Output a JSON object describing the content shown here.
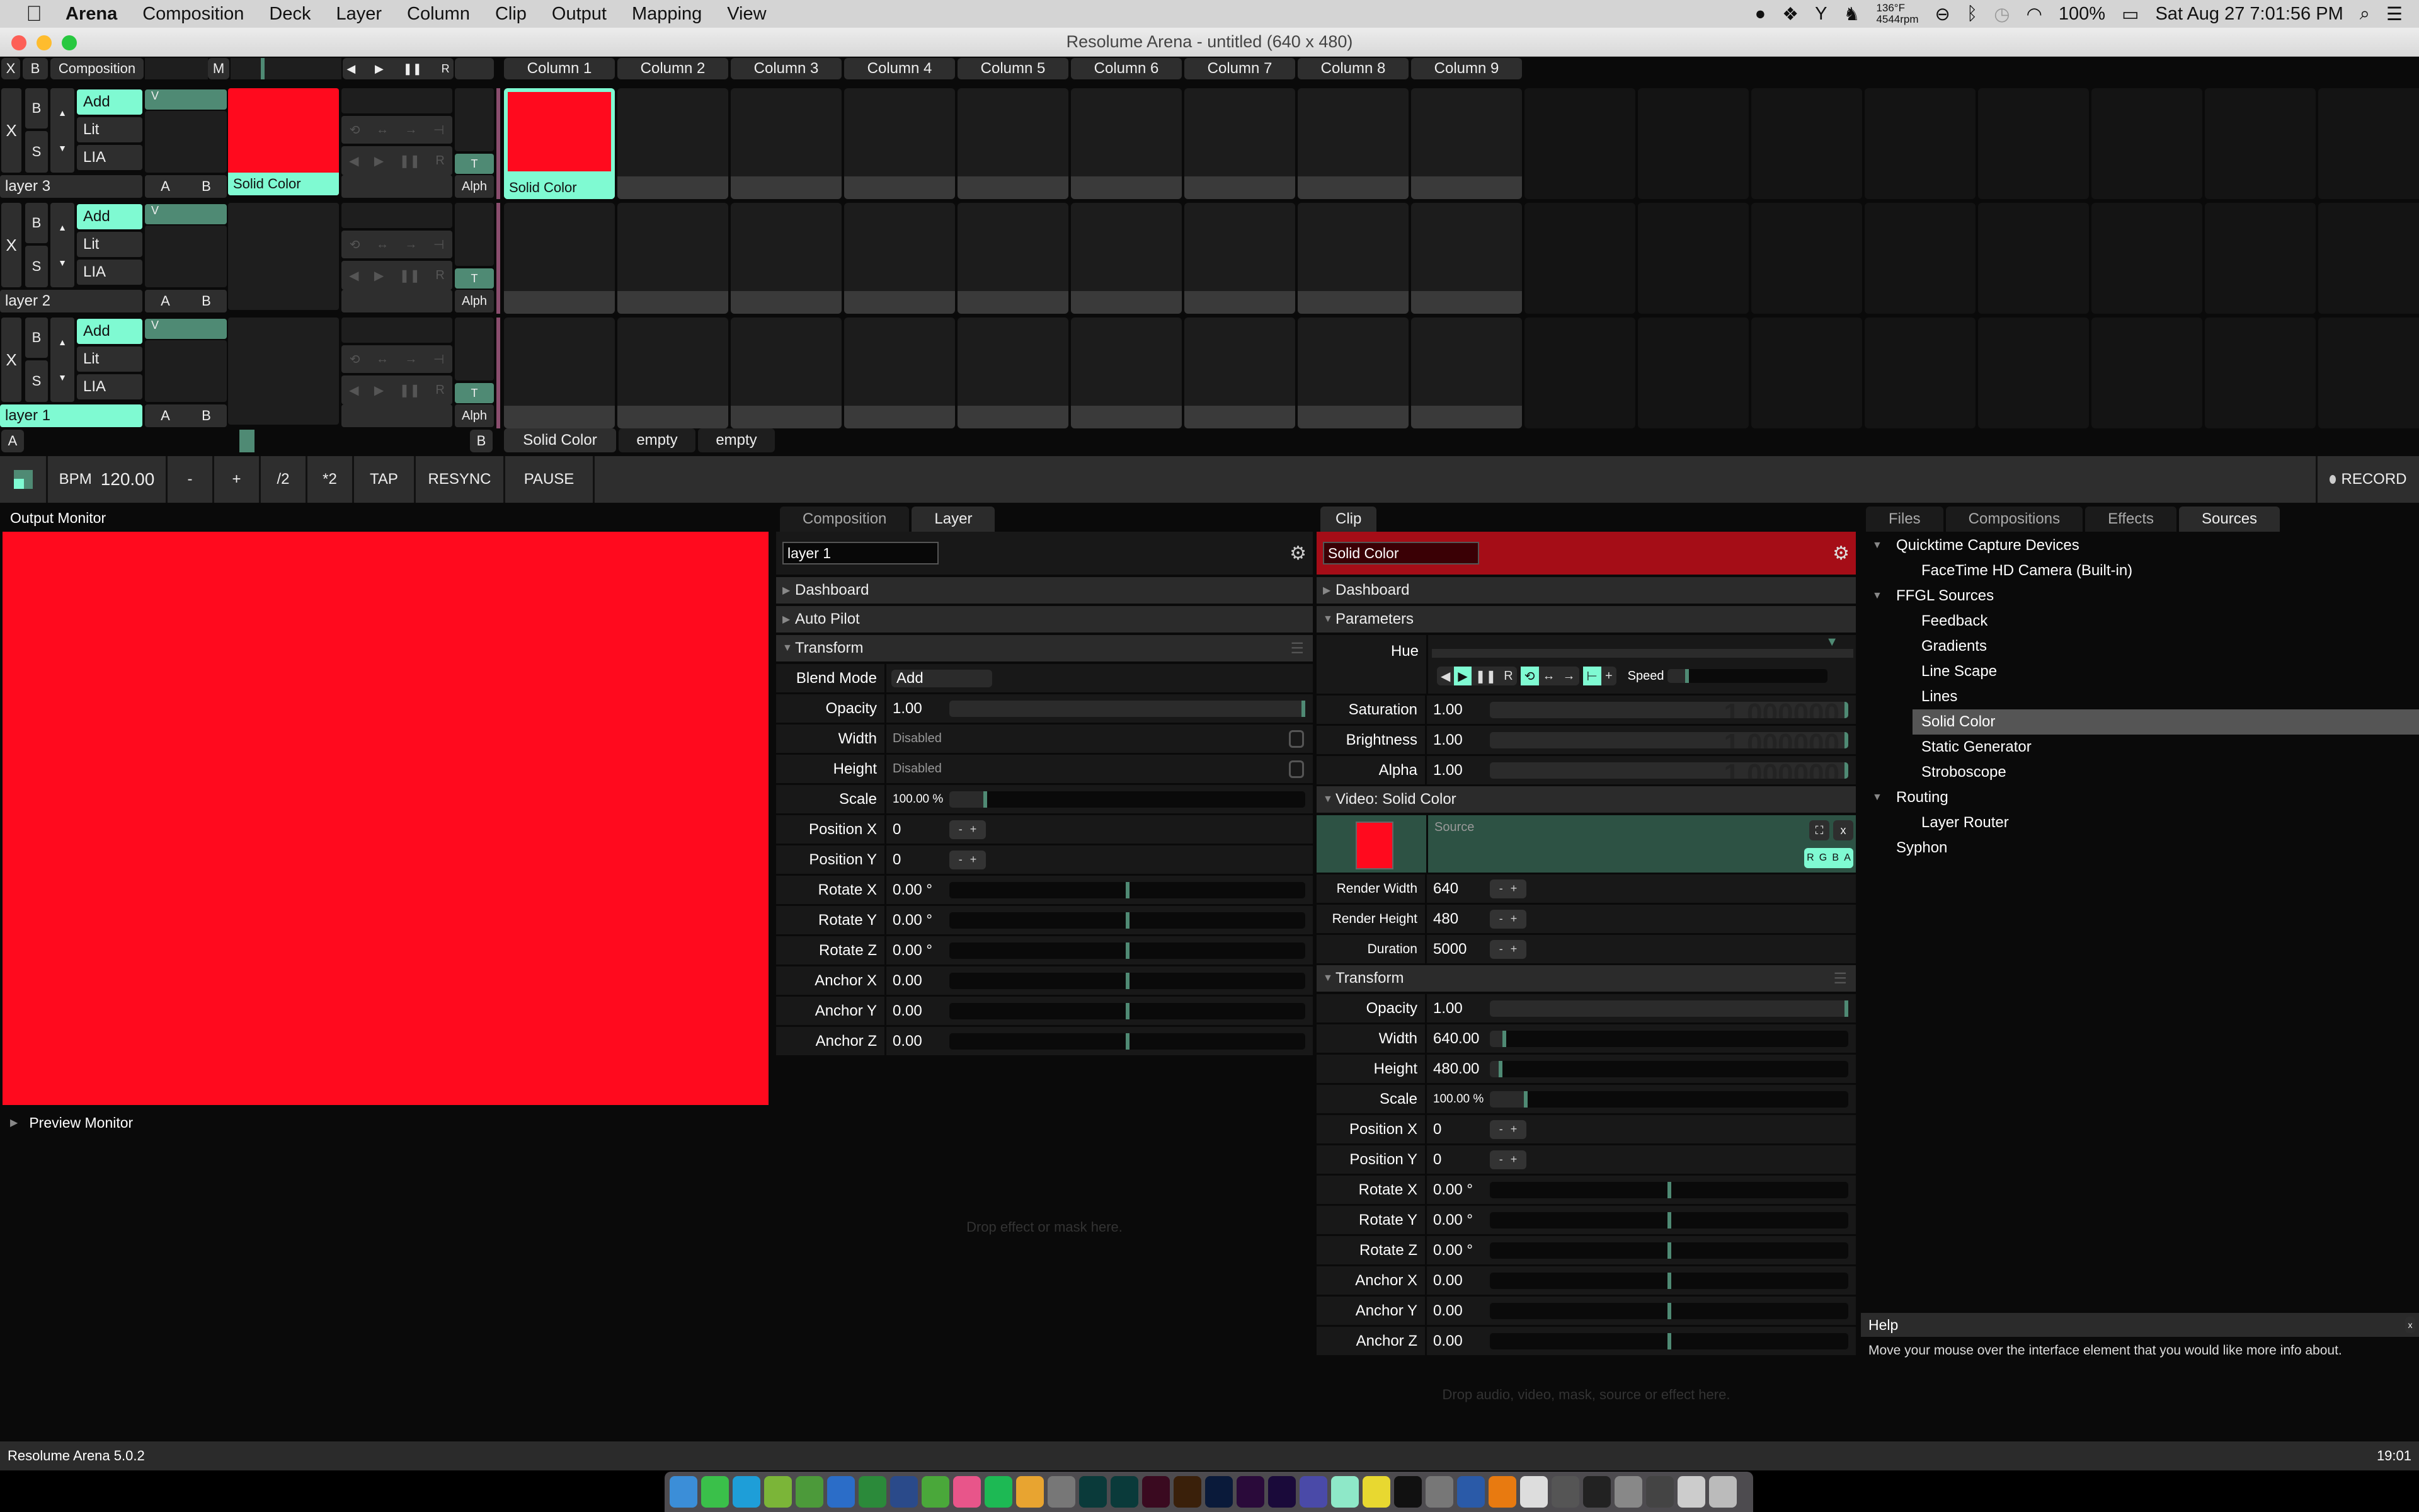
{
  "menubar": {
    "app_name": "Arena",
    "items": [
      "Composition",
      "Deck",
      "Layer",
      "Column",
      "Clip",
      "Output",
      "Mapping",
      "View"
    ],
    "status": {
      "temp": "136°F",
      "fan": "4544rpm",
      "battery": "100%",
      "datetime": "Sat Aug 27  7:01:56 PM"
    }
  },
  "window": {
    "title": "Resolume Arena - untitled (640 x 480)"
  },
  "deck": {
    "head": {
      "x": "X",
      "b": "B",
      "composition": "Composition",
      "m": "M",
      "prev": "◀",
      "next": "▶",
      "pause": "❚❚",
      "r": "R"
    },
    "columns": [
      "Column 1",
      "Column 2",
      "Column 3",
      "Column 4",
      "Column 5",
      "Column 6",
      "Column 7",
      "Column 8",
      "Column 9"
    ],
    "layers": [
      {
        "name": "layer 3",
        "blend": "Add",
        "lit": "Lit",
        "lia": "LIA",
        "v": "V",
        "t": "T",
        "alph": "Alph",
        "a": "A",
        "b": "B",
        "x": "X",
        "bypass": "B",
        "solo": "S",
        "preview_clip": "Solid Color",
        "active_clip": "Solid Color",
        "selected": false
      },
      {
        "name": "layer 2",
        "blend": "Add",
        "lit": "Lit",
        "lia": "LIA",
        "v": "V",
        "t": "T",
        "alph": "Alph",
        "a": "A",
        "b": "B",
        "x": "X",
        "bypass": "B",
        "solo": "S",
        "preview_clip": "",
        "active_clip": "",
        "selected": false
      },
      {
        "name": "layer 1",
        "blend": "Add",
        "lit": "Lit",
        "lia": "LIA",
        "v": "V",
        "t": "T",
        "alph": "Alph",
        "a": "A",
        "b": "B",
        "x": "X",
        "bypass": "B",
        "solo": "S",
        "preview_clip": "",
        "active_clip": "",
        "selected": true
      }
    ],
    "crossfader": {
      "a": "A",
      "b": "B",
      "position": 0.5
    },
    "decks": [
      "Solid Color",
      "empty",
      "empty"
    ]
  },
  "transport": {
    "bpm_label": "BPM",
    "bpm": "120.00",
    "minus": "-",
    "plus": "+",
    "half": "/2",
    "double": "*2",
    "tap": "TAP",
    "resync": "RESYNC",
    "pause": "PAUSE",
    "record": "RECORD"
  },
  "output_monitor": {
    "title": "Output Monitor",
    "color": "#ff0a1e",
    "preview": "Preview Monitor"
  },
  "layer_panel": {
    "tabs": [
      {
        "label": "Composition",
        "active": false
      },
      {
        "label": "Layer",
        "active": true
      }
    ],
    "name": "layer 1",
    "sections": {
      "dashboard": "Dashboard",
      "autopilot": "Auto Pilot",
      "transform": "Transform"
    },
    "blend_mode": {
      "label": "Blend Mode",
      "value": "Add"
    },
    "opacity": {
      "label": "Opacity",
      "value": "1.00",
      "fraction": 1.0
    },
    "width": {
      "label": "Width",
      "value": "Disabled"
    },
    "height": {
      "label": "Height",
      "value": "Disabled"
    },
    "scale": {
      "label": "Scale",
      "value": "100.00 %",
      "fraction": 0.1
    },
    "position_x": {
      "label": "Position X",
      "value": "0"
    },
    "position_y": {
      "label": "Position Y",
      "value": "0"
    },
    "sliders": [
      {
        "label": "Rotate X",
        "value": "0.00 °",
        "fraction": 0.5
      },
      {
        "label": "Rotate Y",
        "value": "0.00 °",
        "fraction": 0.5
      },
      {
        "label": "Rotate Z",
        "value": "0.00 °",
        "fraction": 0.5
      },
      {
        "label": "Anchor X",
        "value": "0.00",
        "fraction": 0.5
      },
      {
        "label": "Anchor Y",
        "value": "0.00",
        "fraction": 0.5
      },
      {
        "label": "Anchor Z",
        "value": "0.00",
        "fraction": 0.5
      }
    ],
    "drop_hint": "Drop effect or mask here."
  },
  "clip_panel": {
    "tab": "Clip",
    "name": "Solid Color",
    "sections": {
      "dashboard": "Dashboard",
      "parameters": "Parameters",
      "video": "Video: Solid Color",
      "transform": "Transform"
    },
    "hue": {
      "label": "Hue",
      "speed_label": "Speed",
      "speed_fraction": 0.12
    },
    "params": [
      {
        "label": "Saturation",
        "value": "1.00",
        "ghost": "1.000000",
        "fraction": 1.0
      },
      {
        "label": "Brightness",
        "value": "1.00",
        "ghost": "1.000000",
        "fraction": 1.0
      },
      {
        "label": "Alpha",
        "value": "1.00",
        "ghost": "1.000000",
        "fraction": 1.0
      }
    ],
    "source": {
      "label": "Source",
      "rgba": [
        "R",
        "G",
        "B",
        "A"
      ],
      "color": "#ff0a1e"
    },
    "render": [
      {
        "label": "Render Width",
        "value": "640"
      },
      {
        "label": "Render Height",
        "value": "480"
      },
      {
        "label": "Duration",
        "value": "5000"
      }
    ],
    "transform_sliders": [
      {
        "label": "Opacity",
        "value": "1.00",
        "fraction": 1.0,
        "filled": true
      },
      {
        "label": "Width",
        "value": "640.00",
        "fraction": 0.04,
        "filled": true
      },
      {
        "label": "Height",
        "value": "480.00",
        "fraction": 0.03,
        "filled": true
      },
      {
        "label": "Scale",
        "value": "100.00 %",
        "fraction": 0.1,
        "filled": true
      }
    ],
    "position_x": {
      "label": "Position X",
      "value": "0"
    },
    "position_y": {
      "label": "Position Y",
      "value": "0"
    },
    "sliders": [
      {
        "label": "Rotate X",
        "value": "0.00 °",
        "fraction": 0.5
      },
      {
        "label": "Rotate Y",
        "value": "0.00 °",
        "fraction": 0.5
      },
      {
        "label": "Rotate Z",
        "value": "0.00 °",
        "fraction": 0.5
      },
      {
        "label": "Anchor X",
        "value": "0.00",
        "fraction": 0.5
      },
      {
        "label": "Anchor Y",
        "value": "0.00",
        "fraction": 0.5
      },
      {
        "label": "Anchor Z",
        "value": "0.00",
        "fraction": 0.5
      }
    ],
    "drop_hint": "Drop audio, video, mask, source or effect here."
  },
  "browser": {
    "tabs": [
      {
        "label": "Files",
        "active": false
      },
      {
        "label": "Compositions",
        "active": false
      },
      {
        "label": "Effects",
        "active": false
      },
      {
        "label": "Sources",
        "active": true
      }
    ],
    "tree": [
      {
        "type": "group",
        "label": "Quicktime Capture Devices"
      },
      {
        "type": "item",
        "label": "FaceTime HD Camera (Built-in)"
      },
      {
        "type": "group",
        "label": "FFGL Sources"
      },
      {
        "type": "item",
        "label": "Feedback"
      },
      {
        "type": "item",
        "label": "Gradients"
      },
      {
        "type": "item",
        "label": "Line Scape"
      },
      {
        "type": "item",
        "label": "Lines"
      },
      {
        "type": "item",
        "label": "Solid Color",
        "selected": true
      },
      {
        "type": "item",
        "label": "Static Generator"
      },
      {
        "type": "item",
        "label": "Stroboscope"
      },
      {
        "type": "group",
        "label": "Routing"
      },
      {
        "type": "item",
        "label": "Layer Router"
      },
      {
        "type": "leaf",
        "label": "Syphon"
      }
    ]
  },
  "help": {
    "title": "Help",
    "close": "x",
    "text": "Move your mouse over the interface element that you would like more info about."
  },
  "statusbar": {
    "version": "Resolume Arena 5.0.2",
    "time": "19:01"
  },
  "dock": {
    "apps": [
      "Finder",
      "FaceTime",
      "Skype",
      "uTorrent",
      "Transmit",
      "Word",
      "Excel",
      "Sync",
      "Evernote",
      "iTunes",
      "Spotify",
      "Chrome",
      "Live",
      "Au",
      "Sg",
      "Id",
      "Ai",
      "Ps",
      "Pr",
      "Ae",
      "Motion",
      "Resolume",
      "Vectorworks",
      "Syphon",
      "Inkscape",
      "Cinema4D",
      "VLC",
      "TextEdit",
      "Calculator",
      "Activity Monitor",
      "System Preferences",
      "Joystick",
      "Document",
      "Trash"
    ]
  }
}
